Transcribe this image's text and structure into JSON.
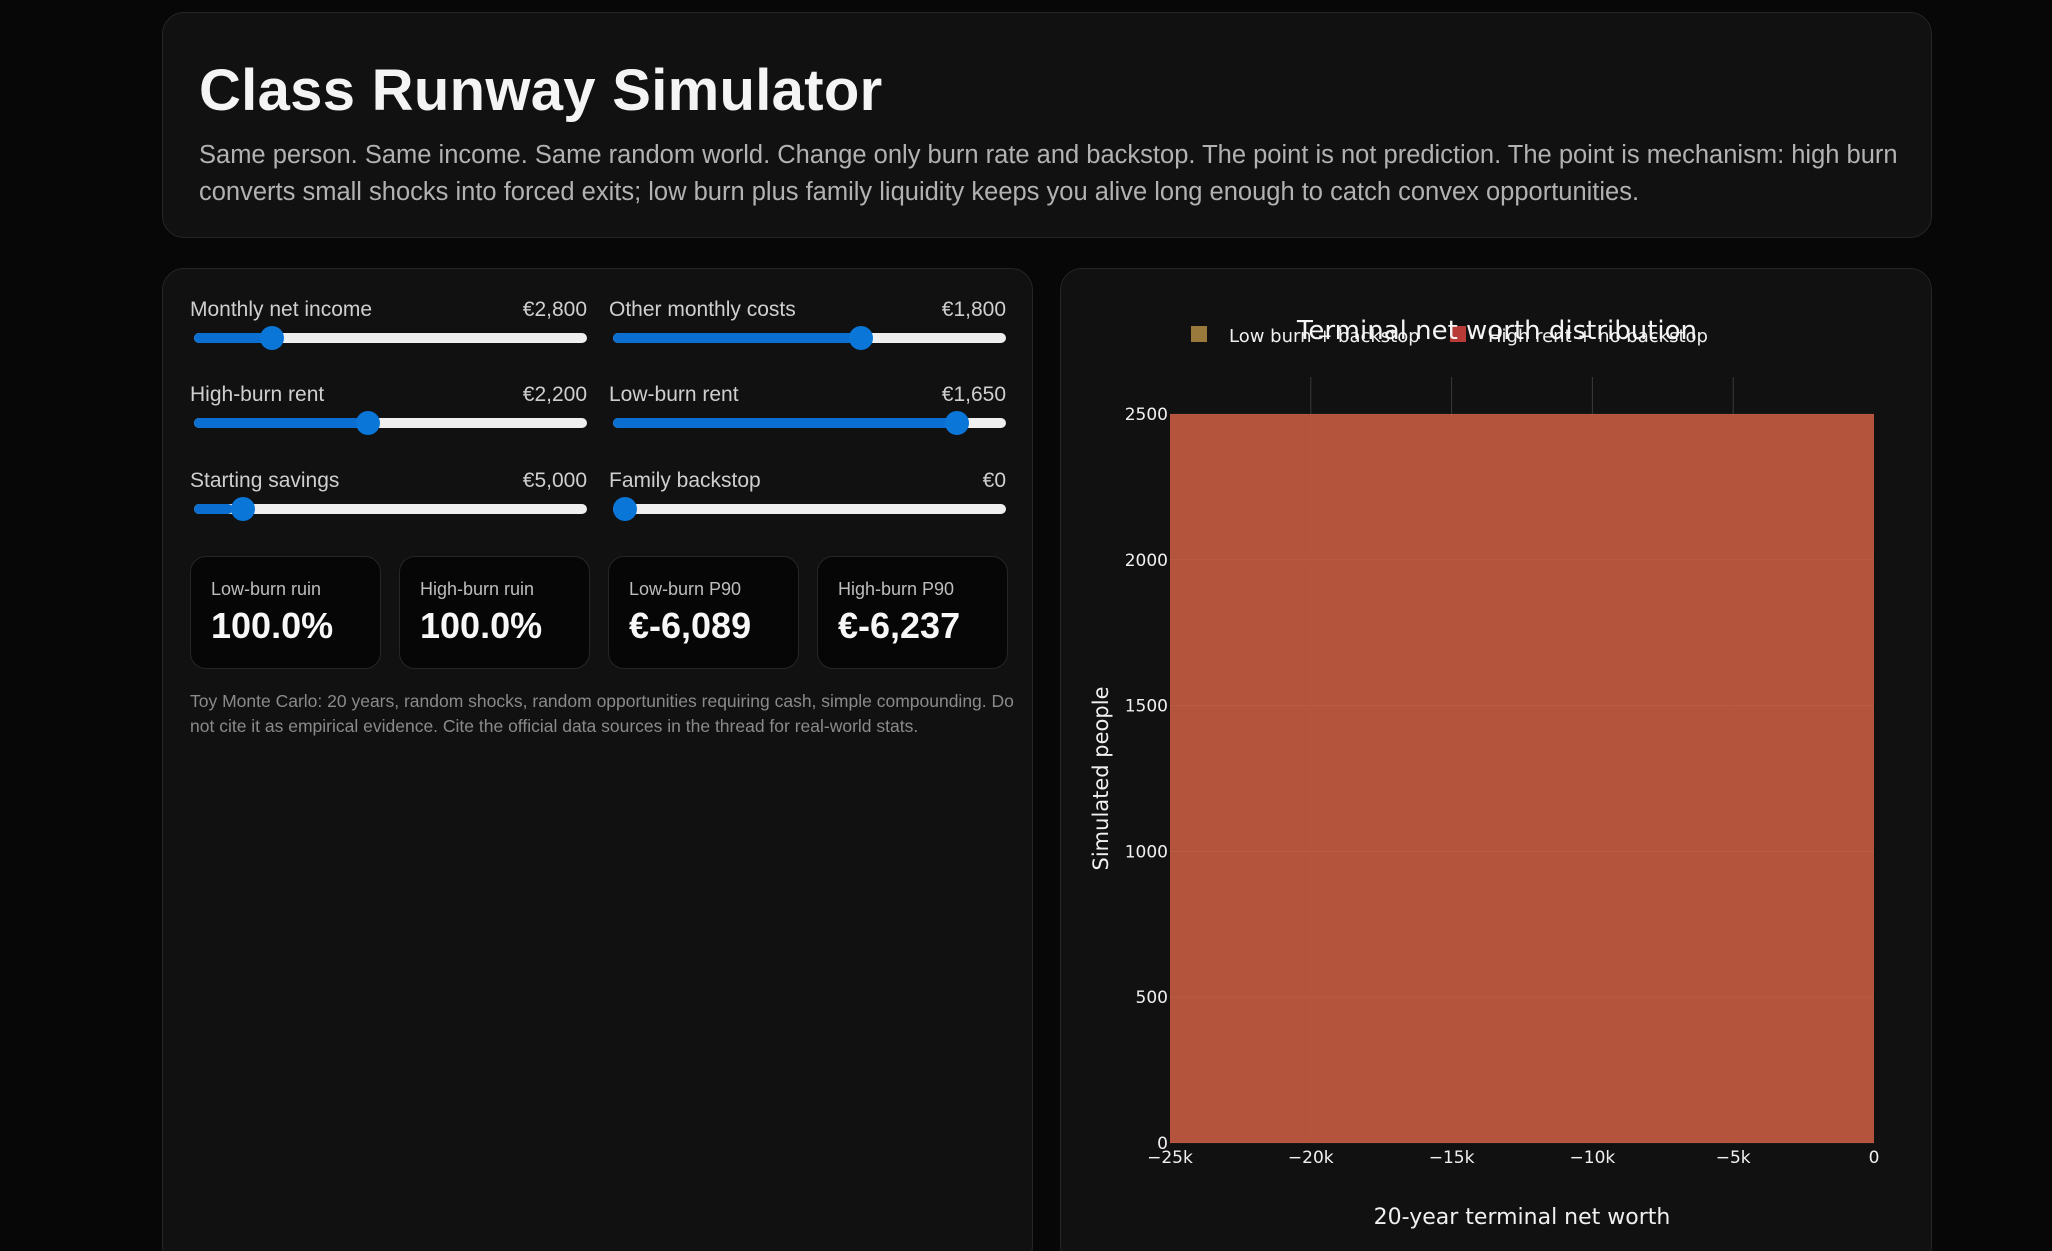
{
  "header": {
    "title": "Class Runway Simulator",
    "subtitle": "Same person. Same income. Same random world. Change only burn rate and backstop. The point is not prediction. The point is mechanism: high burn converts small shocks into forced exits; low burn plus family liquidity keeps you alive long enough to catch convex opportunities."
  },
  "controls": {
    "monthly_net_income": {
      "label": "Monthly net income",
      "value": "€2,800",
      "fraction": 0.18
    },
    "other_monthly_costs": {
      "label": "Other monthly costs",
      "value": "€1,800",
      "fraction": 0.64
    },
    "high_burn_rent": {
      "label": "High-burn rent",
      "value": "€2,200",
      "fraction": 0.44
    },
    "low_burn_rent": {
      "label": "Low-burn rent",
      "value": "€1,650",
      "fraction": 0.9
    },
    "starting_savings": {
      "label": "Starting savings",
      "value": "€5,000",
      "fraction": 0.1
    },
    "family_backstop": {
      "label": "Family backstop",
      "value": "€0",
      "fraction": 0.0
    }
  },
  "stats": {
    "low_burn_ruin": {
      "label": "Low-burn ruin",
      "value": "100.0%"
    },
    "high_burn_ruin": {
      "label": "High-burn ruin",
      "value": "100.0%"
    },
    "low_burn_p90": {
      "label": "Low-burn P90",
      "value": "€-6,089"
    },
    "high_burn_p90": {
      "label": "High-burn P90",
      "value": "€-6,237"
    }
  },
  "note": "Toy Monte Carlo: 20 years, random shocks, random opportunities requiring cash, simple compounding. Do not cite it as empirical evidence. Cite the official data sources in the thread for real-world stats.",
  "colors": {
    "accent": "#0a6fd1",
    "low_burn_series": "#9a7a3c",
    "high_burn_series": "#b83b38",
    "histogram_fill": "#bd553e"
  },
  "chart_data": {
    "type": "bar",
    "title": "Terminal net worth distribution",
    "xlabel": "20-year terminal net worth",
    "ylabel": "Simulated people",
    "xlim": [
      -25000,
      0
    ],
    "ylim": [
      0,
      2500
    ],
    "x_ticks": [
      -25000,
      -20000,
      -15000,
      -10000,
      -5000,
      0
    ],
    "x_tick_labels": [
      "−25k",
      "−20k",
      "−15k",
      "−10k",
      "−5k",
      "0"
    ],
    "y_ticks": [
      0,
      500,
      1000,
      1500,
      2000,
      2500
    ],
    "y_tick_labels": [
      "0",
      "500",
      "1000",
      "1500",
      "2000",
      "2500"
    ],
    "legend_position": "top",
    "grid": true,
    "series": [
      {
        "name": "Low burn + backstop",
        "color": "#9a7a3c",
        "bins": [
          {
            "x0": -25000,
            "x1": 0,
            "count": 2500
          }
        ]
      },
      {
        "name": "High rent + no backstop",
        "color": "#b83b38",
        "bins": [
          {
            "x0": -25000,
            "x1": 0,
            "count": 2500
          }
        ]
      }
    ]
  }
}
